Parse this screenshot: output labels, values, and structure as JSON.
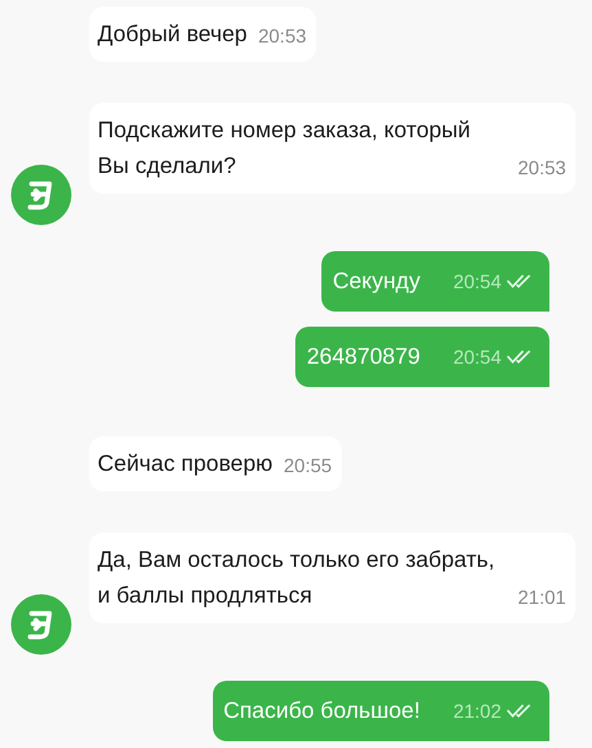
{
  "messages": [
    {
      "kind": "incoming",
      "text": "Добрый вечер",
      "time": "20:53",
      "avatar": false
    },
    {
      "kind": "incoming",
      "text": "Подскажите номер заказа, который Вы сделали?",
      "time": "20:53",
      "avatar": true
    },
    {
      "kind": "outgoing",
      "text": "Секунду",
      "time": "20:54",
      "read": true
    },
    {
      "kind": "outgoing",
      "text": "264870879",
      "time": "20:54",
      "read": true
    },
    {
      "kind": "incoming",
      "text": "Сейчас проверю",
      "time": "20:55",
      "avatar": false
    },
    {
      "kind": "incoming",
      "text": "Да, Вам осталось только его забрать, и баллы продляться",
      "time": "21:01",
      "avatar": true
    },
    {
      "kind": "outgoing",
      "text": "Спасибо большое!",
      "time": "21:02",
      "read": true
    }
  ]
}
